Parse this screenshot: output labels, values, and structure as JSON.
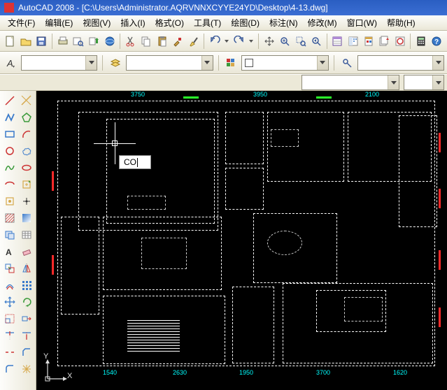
{
  "title": "AutoCAD 2008 - [C:\\Users\\Administrator.AQRVNNXCYYE24YD\\Desktop\\4-13.dwg]",
  "menus": {
    "file": "文件(F)",
    "edit": "编辑(E)",
    "view": "视图(V)",
    "insert": "插入(I)",
    "format": "格式(O)",
    "tools": "工具(T)",
    "draw": "绘图(D)",
    "dim": "标注(N)",
    "modify": "修改(M)",
    "window": "窗口(W)",
    "help": "帮助(H)"
  },
  "toolbar_icons": {
    "new": "new",
    "open": "open",
    "save": "save",
    "plot": "plot",
    "preview": "preview",
    "publish": "publish",
    "dwf": "dwf",
    "cut": "cut",
    "copy": "copy",
    "paste": "paste",
    "match": "match",
    "brush": "brush",
    "undo": "undo",
    "redo": "redo",
    "pan": "pan",
    "zoomrt": "zoomrt",
    "zoomwin": "zoomwin",
    "zoomprev": "zoomprev",
    "props": "props",
    "dc": "dc",
    "tp": "tp",
    "ssm": "ssm",
    "mark": "mark",
    "calc": "calc",
    "helpq": "helpq"
  },
  "combos": {
    "layer": "",
    "color": "",
    "linetype": "",
    "lineweight": "",
    "plotstyle": "",
    "textstyle": "",
    "dimstyle": ""
  },
  "command_input": "CO",
  "ucs": {
    "x": "X",
    "y": "Y"
  },
  "dim_labels": {
    "t1": "3750",
    "t2": "3950",
    "t3": "2100",
    "b1": "1540",
    "b2": "2630",
    "b3": "1950",
    "b4": "3700",
    "b5": "1620"
  }
}
